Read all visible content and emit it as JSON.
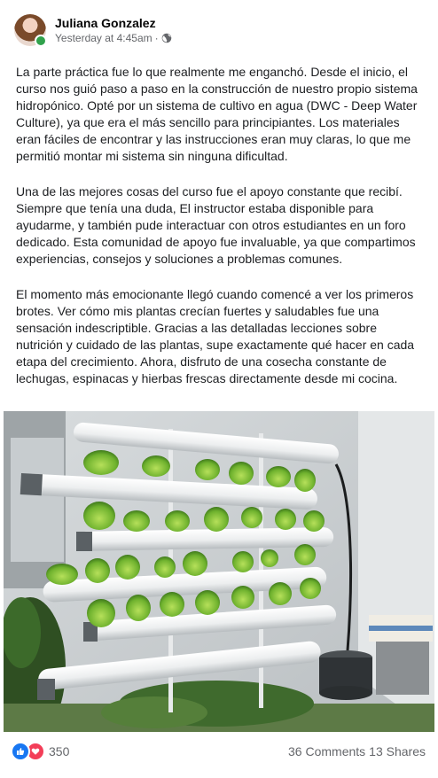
{
  "post": {
    "author": "Juliana Gonzalez",
    "timestamp": "Yesterday at 4:45am",
    "separator": "·",
    "privacy_icon": "globe-icon",
    "paragraphs": [
      "La parte práctica fue lo que realmente me enganchó. Desde el inicio, el curso nos guió paso a paso en la construcción de nuestro propio sistema hidropónico. Opté por un sistema de cultivo en agua (DWC - Deep Water Culture), ya que era el más sencillo para principiantes. Los materiales eran fáciles de encontrar y las instrucciones eran muy claras, lo que me permitió montar mi sistema sin ninguna dificultad.",
      "Una de las mejores cosas del curso fue el apoyo constante que recibí. Siempre que tenía una duda, El instructor estaba disponible para ayudarme, y también pude interactuar con otros estudiantes en un foro dedicado. Esta comunidad de apoyo fue invaluable, ya que compartimos experiencias, consejos y soluciones a problemas comunes.",
      "El momento más emocionante llegó cuando comencé a ver los primeros brotes. Ver cómo mis plantas crecían fuertes y saludables fue una sensación indescriptible. Gracias a las detalladas lecciones sobre nutrición y cuidado de las plantas, supe exactamente qué hacer en cada etapa del crecimiento. Ahora, disfruto de una cosecha constante de lechugas, espinacas y hierbas frescas directamente desde mi cocina."
    ]
  },
  "reactions": {
    "icons": [
      "like-icon",
      "love-icon"
    ],
    "count": "350",
    "comments": "36 Comments",
    "shares": "13 Shares",
    "like_color": "#1877f2",
    "love_color": "#f33e58"
  }
}
